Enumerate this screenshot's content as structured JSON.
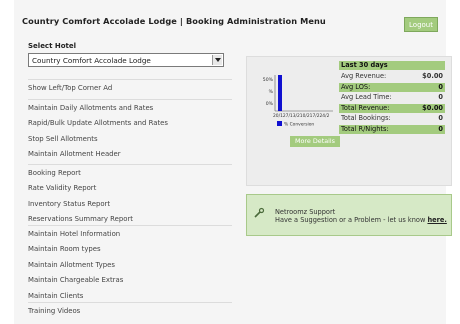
{
  "header": {
    "title": "Country Comfort Accolade Lodge | Booking Administration Menu",
    "logout_label": "Logout"
  },
  "hotel_select": {
    "label": "Select Hotel",
    "value": "Country Comfort Accolade Lodge"
  },
  "menu": {
    "groups": [
      [
        "Show Left/Top Corner Ad"
      ],
      [
        "Maintain Daily Allotments and Rates",
        "Rapid/Bulk Update Allotments and Rates",
        "Stop Sell Allotments",
        "Maintain Allotment Header"
      ],
      [
        "Booking Report",
        "Rate Validity Report",
        "Inventory Status Report",
        "Reservations Summary Report"
      ],
      [
        "Maintain Hotel Information",
        "Maintain Room types",
        "Maintain Allotment Types",
        "Maintain Chargeable Extras",
        "Maintain Clients"
      ],
      [
        "Training Videos"
      ]
    ]
  },
  "stats": {
    "period": "Last 30 days",
    "rows": [
      {
        "label": "Avg Revenue:",
        "value": "$0.00",
        "highlight": false
      },
      {
        "label": "Avg LOS:",
        "value": "0",
        "highlight": true
      },
      {
        "label": "Avg Lead Time:",
        "value": "0",
        "highlight": false
      },
      {
        "label": "Total Revenue:",
        "value": "$0.00",
        "highlight": true
      },
      {
        "label": "Total Bookings:",
        "value": "0",
        "highlight": false
      },
      {
        "label": "Total R/Nights:",
        "value": "0",
        "highlight": true
      }
    ],
    "more_label": "More Details"
  },
  "chart_data": {
    "type": "bar",
    "categories": [
      "20/12",
      "7/12",
      "13/2",
      "10/2",
      "17/2",
      "24/2"
    ],
    "series": [
      {
        "name": "% Conversion",
        "values": [
          100,
          0,
          0,
          0,
          0,
          0
        ]
      }
    ],
    "ylim": [
      0,
      100
    ],
    "y_ticks": [
      "50%",
      "%",
      "0%"
    ],
    "x_tick_text": "20/127/13/210/217/224/2"
  },
  "support": {
    "title": "Netroomz Support",
    "text": "Have a Suggestion or a Problem - let us know ",
    "link": "here."
  },
  "colors": {
    "accent": "#a3cb7e",
    "bar": "#1010d0"
  }
}
